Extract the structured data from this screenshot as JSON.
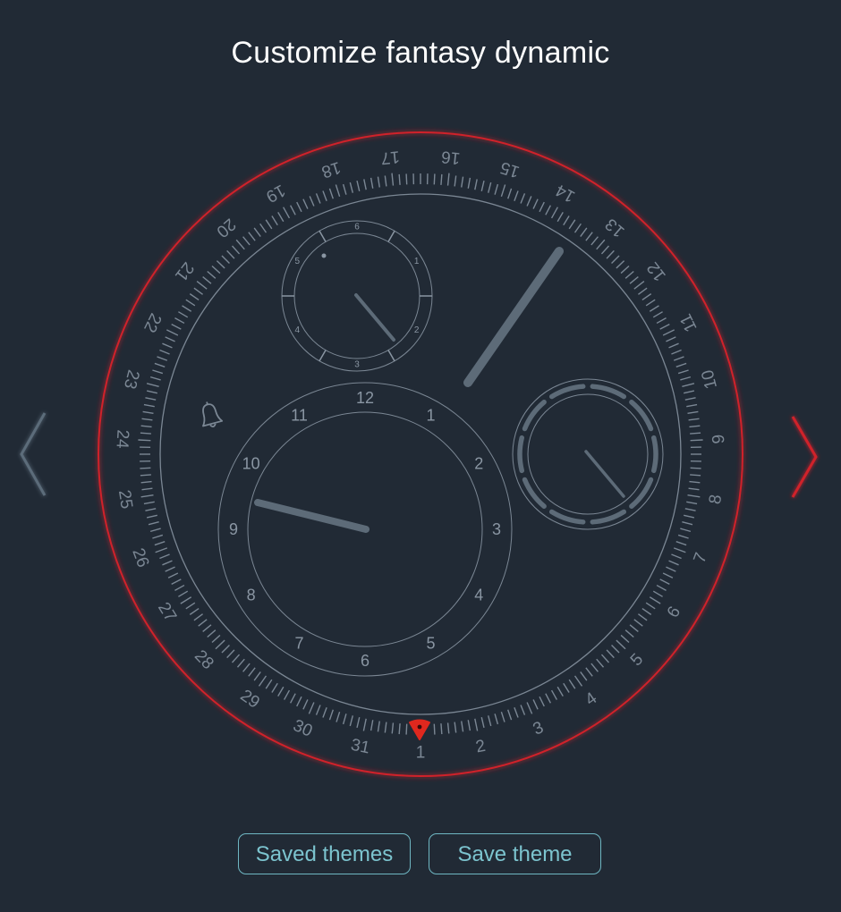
{
  "header": {
    "title": "Customize fantasy dynamic"
  },
  "colors": {
    "background": "#212a35",
    "accent_red": "#d0202a",
    "dial_line": "#7b8794",
    "hand": "#5d6b78",
    "button_text": "#7cc4cf"
  },
  "outer_scale": {
    "labels": [
      "1",
      "2",
      "3",
      "4",
      "5",
      "6",
      "7",
      "8",
      "9",
      "10",
      "11",
      "12",
      "13",
      "14",
      "15",
      "16",
      "17",
      "18",
      "19",
      "20",
      "21",
      "22",
      "23",
      "24",
      "25",
      "26",
      "27",
      "28",
      "29",
      "30",
      "31"
    ]
  },
  "main_dial": {
    "labels": [
      "12",
      "1",
      "2",
      "3",
      "4",
      "5",
      "6",
      "7",
      "8",
      "9",
      "10",
      "11"
    ]
  },
  "small_dial": {
    "labels": [
      "6",
      "1",
      "2",
      "3",
      "4",
      "5"
    ]
  },
  "icons": {
    "alarm": "bell-icon",
    "date_marker": "date-pointer-icon",
    "prev": "chevron-left-icon",
    "next": "chevron-right-icon"
  },
  "buttons": {
    "saved_themes": "Saved themes",
    "save_theme": "Save theme"
  }
}
